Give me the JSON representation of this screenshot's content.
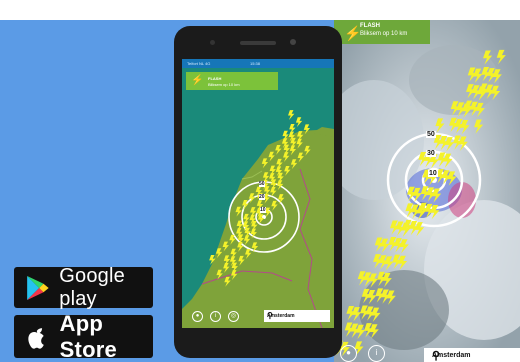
{
  "stores": {
    "google_play_label": "Google play",
    "app_store_label": "App Store",
    "google_play_icon": "play-triangle-icon",
    "app_store_icon": "apple-icon"
  },
  "phone": {
    "statusbar": {
      "carrier": "Telfort NL 4G",
      "time": "15:38"
    },
    "notification": {
      "title": "FLASH",
      "subtitle": "Bliksem op 10 km"
    },
    "rings": [
      "50",
      "20",
      "10"
    ],
    "location": "Amsterdam"
  },
  "radar": {
    "notification": {
      "title": "FLASH",
      "subtitle": "Bliksem op 10 km"
    },
    "rings": [
      "50",
      "30",
      "10"
    ],
    "location": "Amsterdam"
  },
  "colors": {
    "background": "#5b9be6",
    "badge": "#111111",
    "flash_green": "#7cc23a",
    "bolt_yellow": "#f4f22a",
    "land_green": "#7fa33a",
    "sea_teal": "#1a8a7a"
  }
}
